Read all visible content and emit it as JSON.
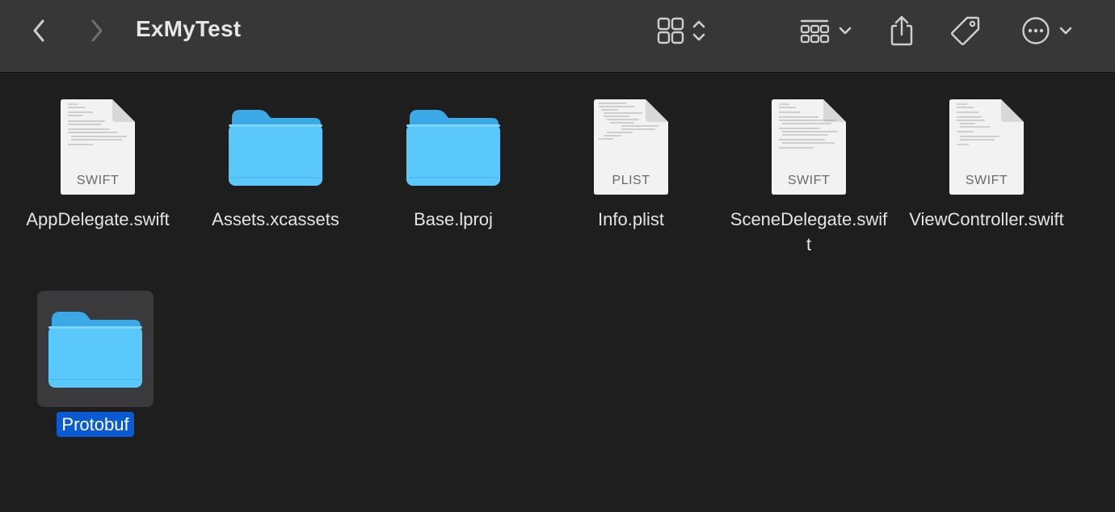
{
  "window": {
    "title": "ExMyTest"
  },
  "toolbar": {
    "back_icon": "chevron-left-icon",
    "forward_icon": "chevron-right-icon",
    "view_icon": "icon-grid-view-icon",
    "group_icon": "group-by-icon",
    "share_icon": "share-icon",
    "tag_icon": "tag-icon",
    "more_icon": "more-actions-icon"
  },
  "items": [
    {
      "name": "AppDelegate.swift",
      "kind": "file",
      "ext": "SWIFT",
      "selected": false
    },
    {
      "name": "Assets.xcassets",
      "kind": "folder",
      "ext": "",
      "selected": false
    },
    {
      "name": "Base.lproj",
      "kind": "folder",
      "ext": "",
      "selected": false
    },
    {
      "name": "Info.plist",
      "kind": "file",
      "ext": "PLIST",
      "selected": false
    },
    {
      "name": "SceneDelegate.swift",
      "kind": "file",
      "ext": "SWIFT",
      "selected": false
    },
    {
      "name": "ViewController.swift",
      "kind": "file",
      "ext": "SWIFT",
      "selected": false
    },
    {
      "name": "Protobuf",
      "kind": "folder",
      "ext": "",
      "selected": true
    }
  ],
  "colors": {
    "toolbar_bg": "#373737",
    "content_bg": "#1e1e1e",
    "folder_blue": "#5ac8fa",
    "selection_blue": "#0a5bd3"
  }
}
